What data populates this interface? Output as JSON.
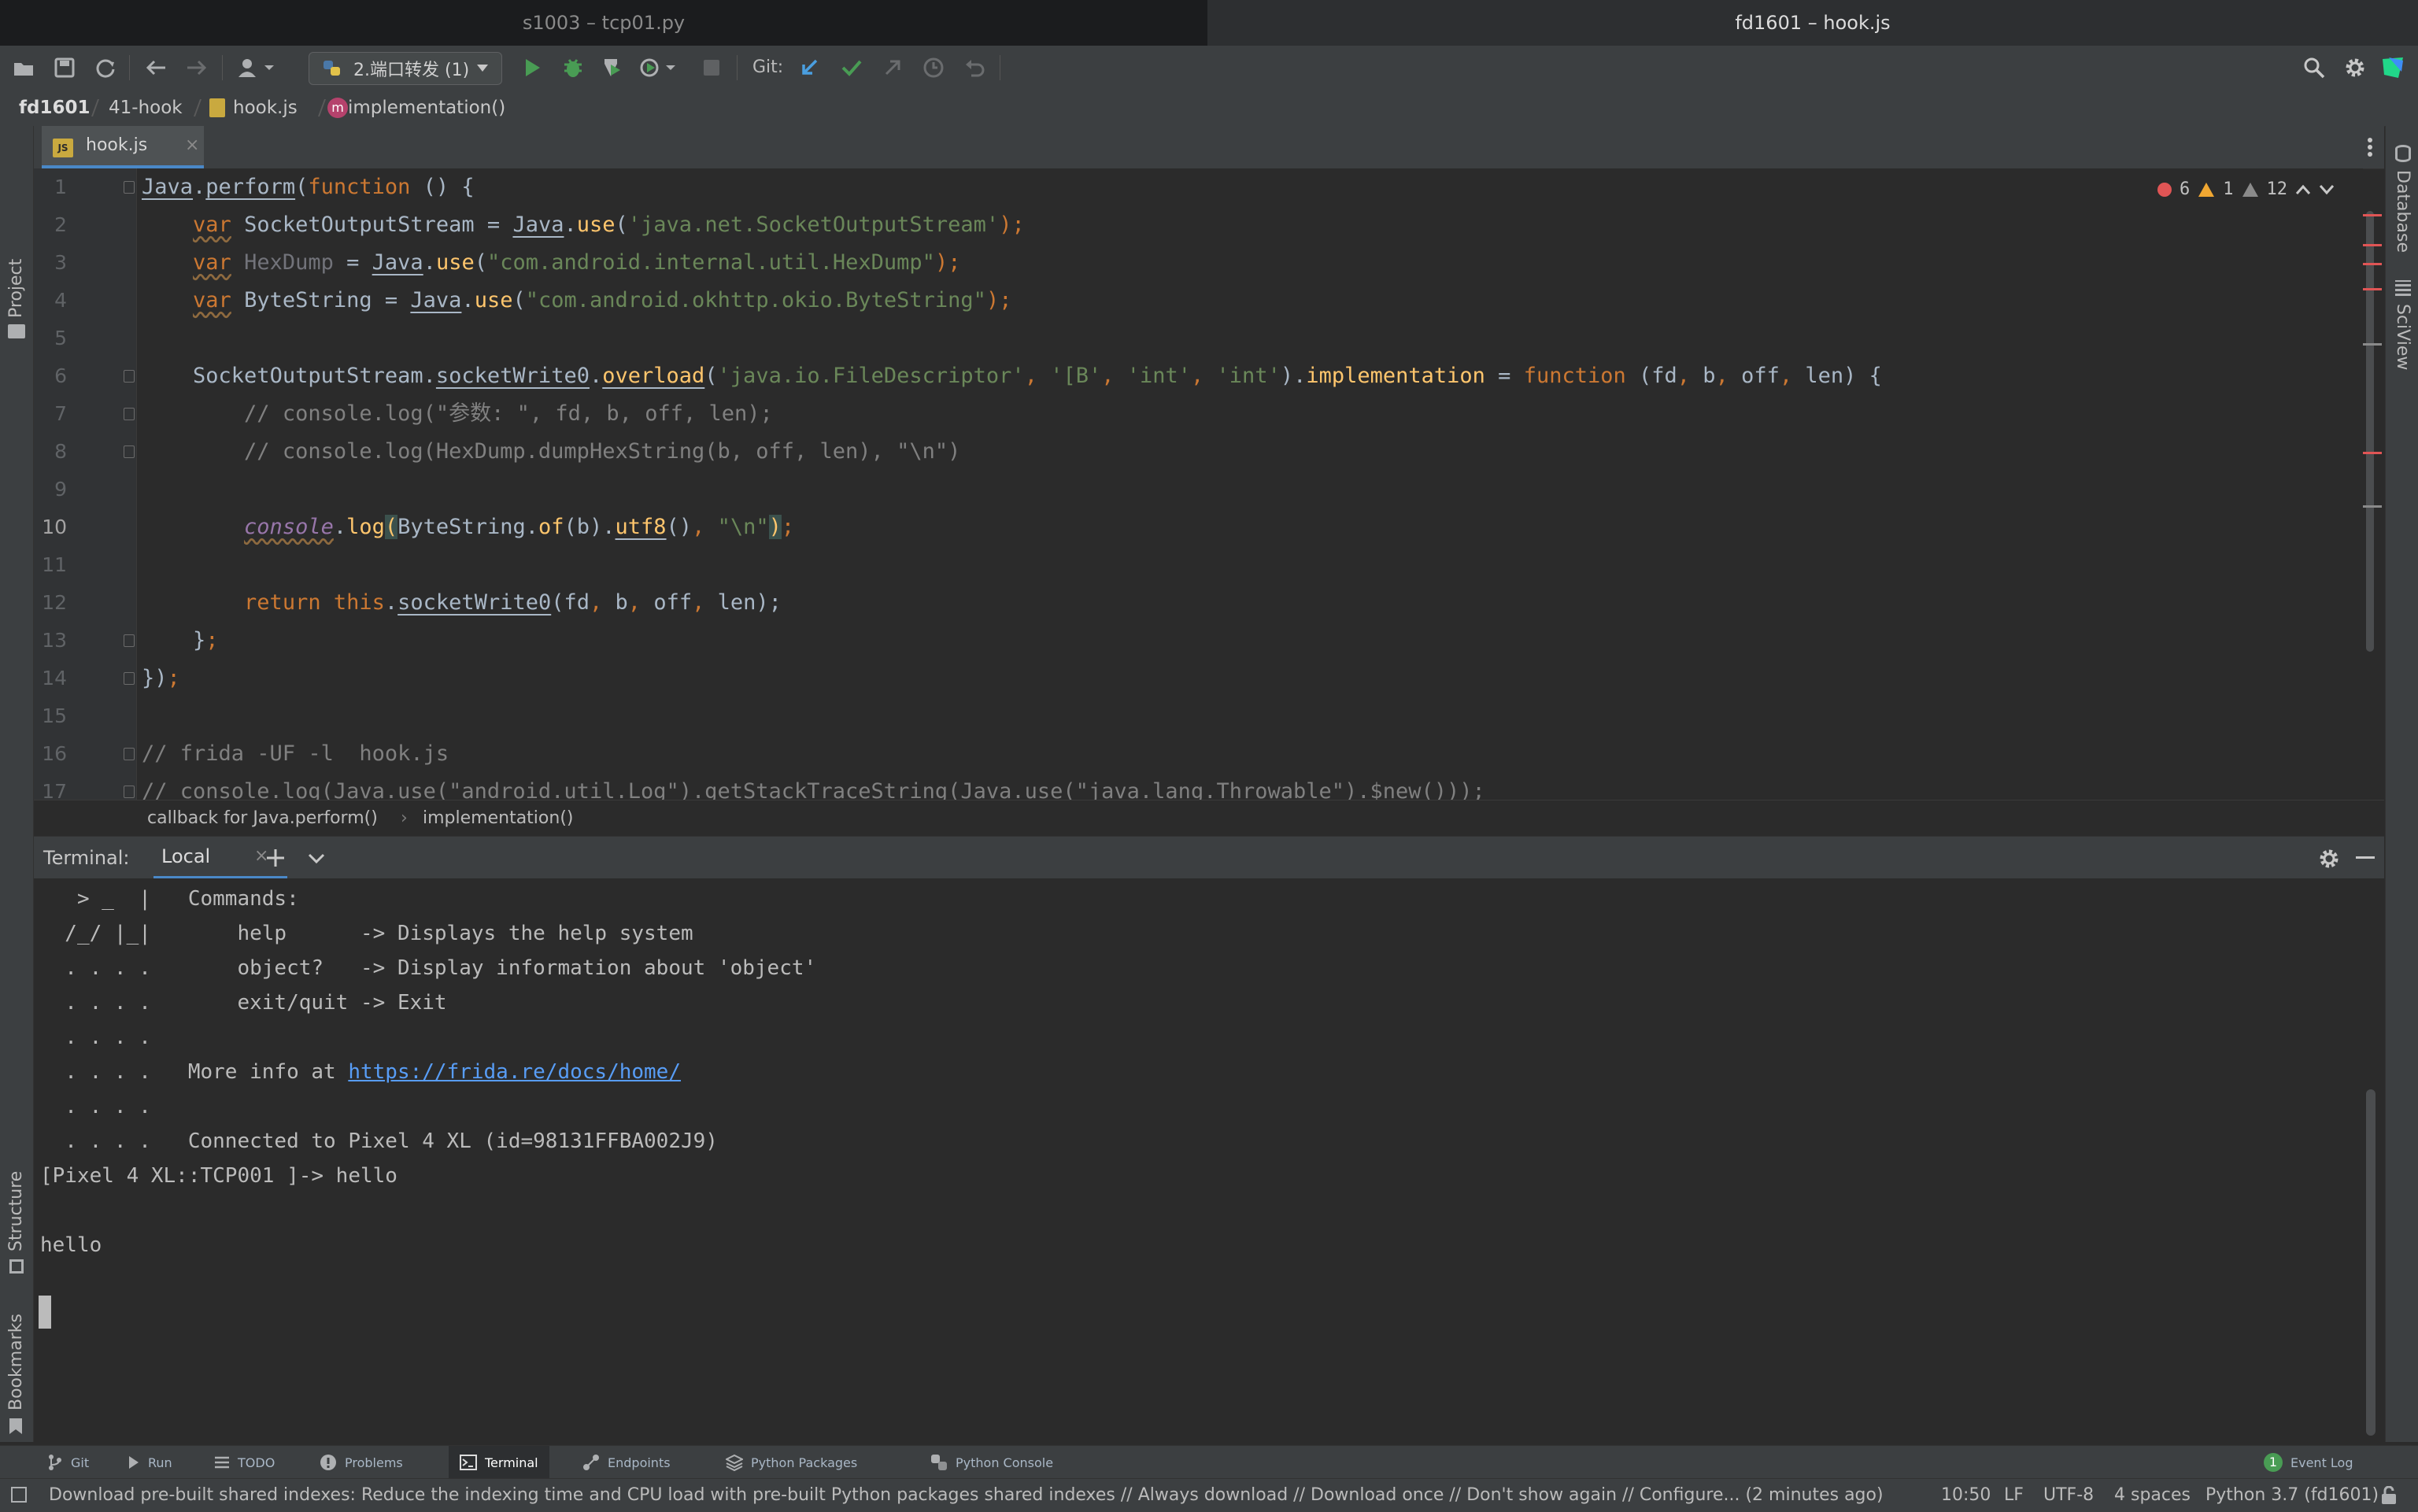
{
  "window_tabs": [
    "s1003 – tcp01.py",
    "fd1601 – hook.js"
  ],
  "toolbar": {
    "run_config": "2.端口转发 (1)",
    "git_label": "Git:"
  },
  "breadcrumbs": [
    "fd1601",
    "41-hook",
    "hook.js",
    "implementation()"
  ],
  "left_strip": {
    "project": "Project",
    "structure": "Structure",
    "bookmarks": "Bookmarks"
  },
  "right_strip": {
    "database": "Database",
    "sciview": "SciView"
  },
  "editor_tab": {
    "name": "hook.js",
    "close": "×",
    "badge": "JS"
  },
  "inspections": {
    "errors": "6",
    "warnings": "1",
    "weak": "12"
  },
  "line_numbers": [
    "1",
    "2",
    "3",
    "4",
    "5",
    "6",
    "7",
    "8",
    "9",
    "10",
    "11",
    "12",
    "13",
    "14",
    "15",
    "16",
    "17"
  ],
  "code": {
    "l1": {
      "a": "Java",
      "b": ".",
      "c": "perform",
      "d": "(",
      "e": "function",
      "f": " () {"
    },
    "l2": {
      "a": "var",
      "b": " SocketOutputStream = ",
      "c": "Java",
      "d": ".",
      "e": "use",
      "f": "(",
      "g": "'java.net.SocketOutputStream'",
      "h": ");"
    },
    "l3": {
      "a": "var",
      "b": " ",
      "c": "HexDump",
      "d": " = ",
      "e": "Java",
      "f": ".",
      "g": "use",
      "h": "(",
      "i": "\"com.android.internal.util.HexDump\"",
      "j": ");"
    },
    "l4": {
      "a": "var",
      "b": " ByteString = ",
      "c": "Java",
      "d": ".",
      "e": "use",
      "f": "(",
      "g": "\"com.android.okhttp.okio.ByteString\"",
      "h": ");"
    },
    "l6": {
      "a": "SocketOutputStream.",
      "b": "socketWrite0",
      "c": ".",
      "d": "overload",
      "e": "(",
      "f": "'java.io.FileDescriptor'",
      "g": ", ",
      "h": "'[B'",
      "i": ", ",
      "j": "'int'",
      "k": ", ",
      "l": "'int'",
      "m": ").",
      "n": "implementation",
      "o": " = ",
      "p": "function",
      "q": " (fd",
      "r": ", ",
      "s": "b",
      "t": ", ",
      "u": "off",
      "v": ", ",
      "w": "len) {"
    },
    "l7": "// console.log(\"参数: \", fd, b, off, len);",
    "l8": "// console.log(HexDump.dumpHexString(b, off, len), \"\\n\")",
    "l10": {
      "a": "console",
      "b": ".",
      "c": "log",
      "d": "(",
      "e": "ByteString.",
      "f": "of",
      "g": "(b).",
      "h": "utf8",
      "i": "()",
      "j": ", ",
      "k": "\"\\n\"",
      "l": ")",
      "m": ";"
    },
    "l12": {
      "a": "return",
      "b": " ",
      "c": "this",
      "d": ".",
      "e": "socketWrite0",
      "f": "(fd",
      "g": ", ",
      "h": "b",
      "i": ", ",
      "j": "off",
      "k": ", ",
      "l": "len);"
    },
    "l13": {
      "a": "}",
      "b": ";"
    },
    "l14": {
      "a": "})",
      "b": ";"
    },
    "l16": "// frida -UF -l  hook.js",
    "l17": "// console.log(Java.use(\"android.util.Log\").getStackTraceString(Java.use(\"java.lang.Throwable\").$new()));"
  },
  "editor_breadcrumbs": [
    "callback for Java.perform()",
    "implementation()"
  ],
  "terminal": {
    "label": "Terminal:",
    "tab": "Local",
    "close": "×",
    "lines": [
      "   > _  |   Commands:",
      "  /_/ |_|       help      -> Displays the help system",
      "  . . . .       object?   -> Display information about 'object'",
      "  . . . .       exit/quit -> Exit",
      "  . . . .",
      "  . . . .   More info at ",
      "  . . . .",
      "  . . . .   Connected to Pixel 4 XL (id=98131FFBA002J9)",
      "[Pixel 4 XL::TCP001 ]-> hello",
      "",
      "hello"
    ],
    "link": "https://frida.re/docs/home/"
  },
  "tool_tabs": [
    "Git",
    "Run",
    "TODO",
    "Problems",
    "Terminal",
    "Endpoints",
    "Python Packages",
    "Python Console"
  ],
  "event_log": {
    "count": "1",
    "label": "Event Log"
  },
  "status": {
    "message": "Download pre-built shared indexes: Reduce the indexing time and CPU load with pre-built Python packages shared indexes // Always download // Download once // Don't show again // Configure... (2 minutes ago)",
    "position": "10:50",
    "line_sep": "LF",
    "encoding": "UTF-8",
    "indent": "4 spaces",
    "interpreter": "Python 3.7 (fd1601)"
  },
  "colors": {
    "accent": "#4a88c7",
    "run_green": "#499c54",
    "error": "#e05555",
    "warning": "#f0a732"
  }
}
